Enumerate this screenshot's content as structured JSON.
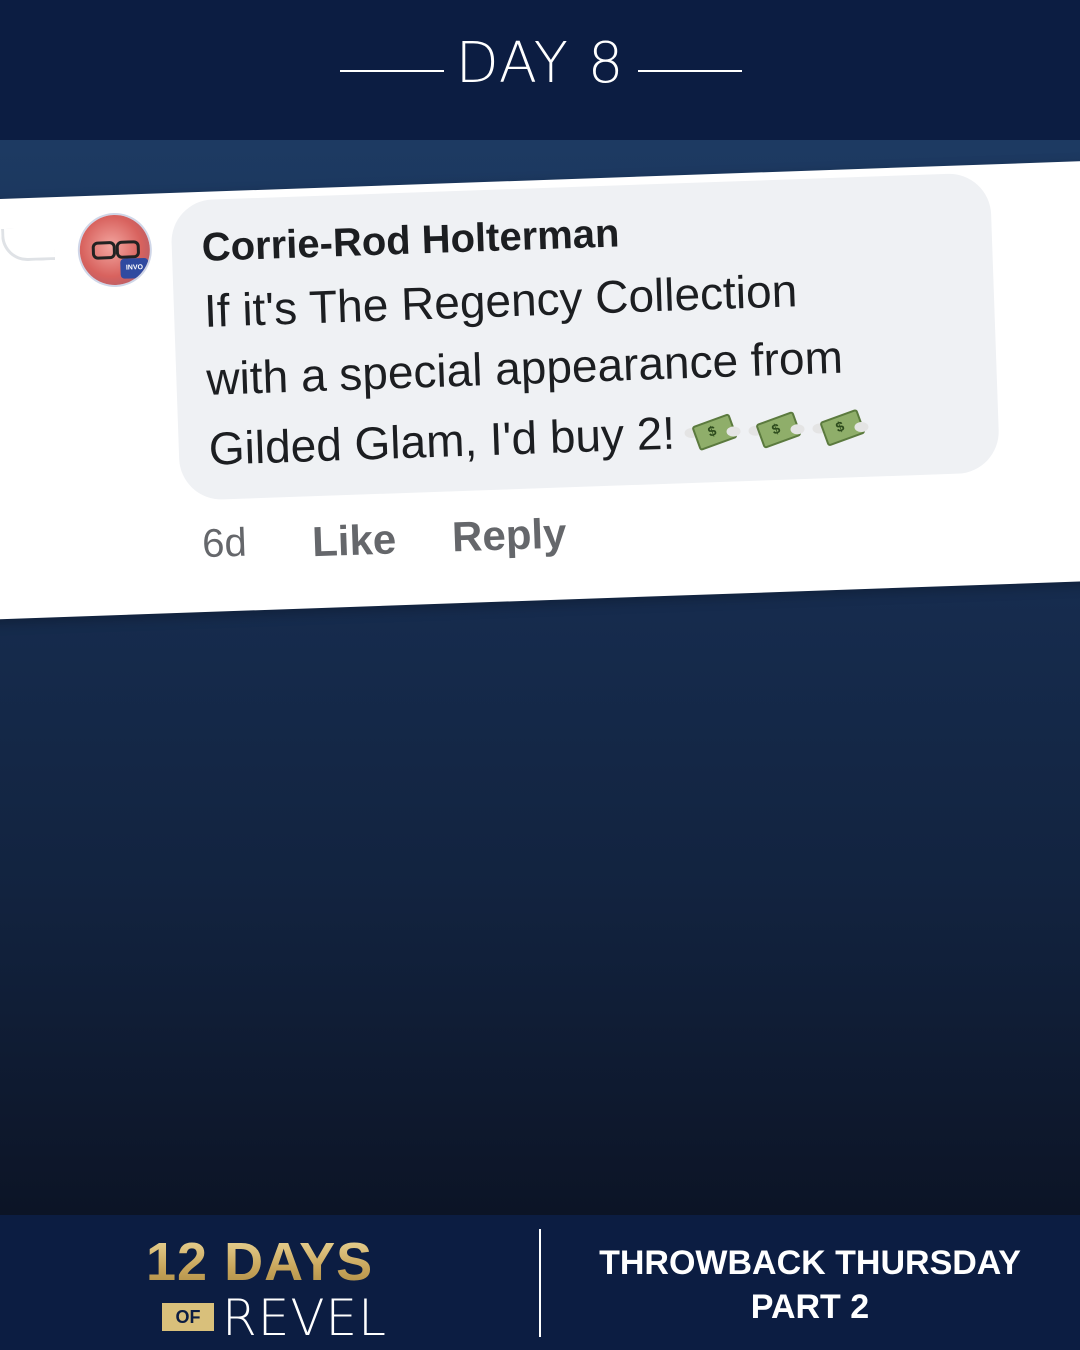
{
  "header": {
    "title": "DAY 8"
  },
  "comment": {
    "author": "Corrie-Rod Holterman",
    "lines": [
      "If it's The Regency Collection",
      "with a special appearance from",
      "Gilded Glam, I'd buy 2!"
    ],
    "emoji": [
      "money-with-wings-icon",
      "money-with-wings-icon",
      "money-with-wings-icon"
    ],
    "avatar_badge": "INVO",
    "timestamp": "6d",
    "like_label": "Like",
    "reply_label": "Reply"
  },
  "footer": {
    "logo_main": "12 DAYS",
    "logo_of": "OF",
    "logo_revel": "REVEL",
    "theme_line1": "THROWBACK THURSDAY",
    "theme_line2": "PART 2"
  },
  "colors": {
    "navy": "#0c1d42",
    "gold": "#d9c07b",
    "bubble": "#eff1f4",
    "meta_text": "#65676b"
  }
}
